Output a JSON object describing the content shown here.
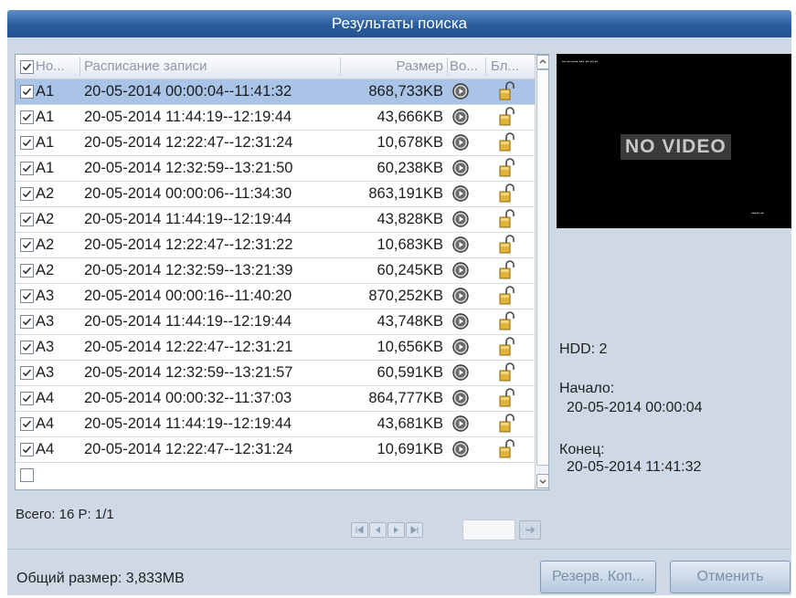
{
  "window": {
    "title": "Результаты поиска"
  },
  "table": {
    "headers": {
      "no": "Но...",
      "schedule": "Расписание записи",
      "size": "Размер",
      "play": "Во...",
      "lock": "Бл..."
    },
    "rows": [
      {
        "camera": "A1",
        "time": "20-05-2014 00:00:04--11:41:32",
        "size": "868,733KB",
        "checked": true,
        "selected": true
      },
      {
        "camera": "A1",
        "time": "20-05-2014 11:44:19--12:19:44",
        "size": "43,666KB",
        "checked": true
      },
      {
        "camera": "A1",
        "time": "20-05-2014 12:22:47--12:31:24",
        "size": "10,678KB",
        "checked": true
      },
      {
        "camera": "A1",
        "time": "20-05-2014 12:32:59--13:21:50",
        "size": "60,238KB",
        "checked": true
      },
      {
        "camera": "A2",
        "time": "20-05-2014 00:00:06--11:34:30",
        "size": "863,191KB",
        "checked": true
      },
      {
        "camera": "A2",
        "time": "20-05-2014 11:44:19--12:19:44",
        "size": "43,828KB",
        "checked": true
      },
      {
        "camera": "A2",
        "time": "20-05-2014 12:22:47--12:31:22",
        "size": "10,683KB",
        "checked": true
      },
      {
        "camera": "A2",
        "time": "20-05-2014 12:32:59--13:21:39",
        "size": "60,245KB",
        "checked": true
      },
      {
        "camera": "A3",
        "time": "20-05-2014 00:00:16--11:40:20",
        "size": "870,252KB",
        "checked": true
      },
      {
        "camera": "A3",
        "time": "20-05-2014 11:44:19--12:19:44",
        "size": "43,748KB",
        "checked": true
      },
      {
        "camera": "A3",
        "time": "20-05-2014 12:22:47--12:31:21",
        "size": "10,656KB",
        "checked": true
      },
      {
        "camera": "A3",
        "time": "20-05-2014 12:32:59--13:21:57",
        "size": "60,591KB",
        "checked": true
      },
      {
        "camera": "A4",
        "time": "20-05-2014 00:00:32--11:37:03",
        "size": "864,777KB",
        "checked": true
      },
      {
        "camera": "A4",
        "time": "20-05-2014 11:44:19--12:19:44",
        "size": "43,681KB",
        "checked": true
      },
      {
        "camera": "A4",
        "time": "20-05-2014 12:22:47--12:31:24",
        "size": "10,691KB",
        "checked": true
      }
    ]
  },
  "pagination": {
    "summary": "Всего: 16  P: 1/1"
  },
  "preview": {
    "no_video": "NO VIDEO"
  },
  "details": {
    "hdd": "HDD: 2",
    "start_label": "Начало:",
    "start_value": "20-05-2014 00:00:04",
    "end_label": "Конец:",
    "end_value": "20-05-2014 11:41:32"
  },
  "footer": {
    "total_size": "Общий размер: 3,833MB",
    "backup_label": "Резерв. Коп...",
    "cancel_label": "Отменить"
  },
  "icons": {
    "play": "play-circle-icon",
    "lock": "unlocked-padlock-icon",
    "check": "checkmark-icon"
  },
  "colors": {
    "title_bar": "#2a5d9f",
    "panel": "#cfd9e6",
    "selected_row": "#a9c4e6"
  }
}
